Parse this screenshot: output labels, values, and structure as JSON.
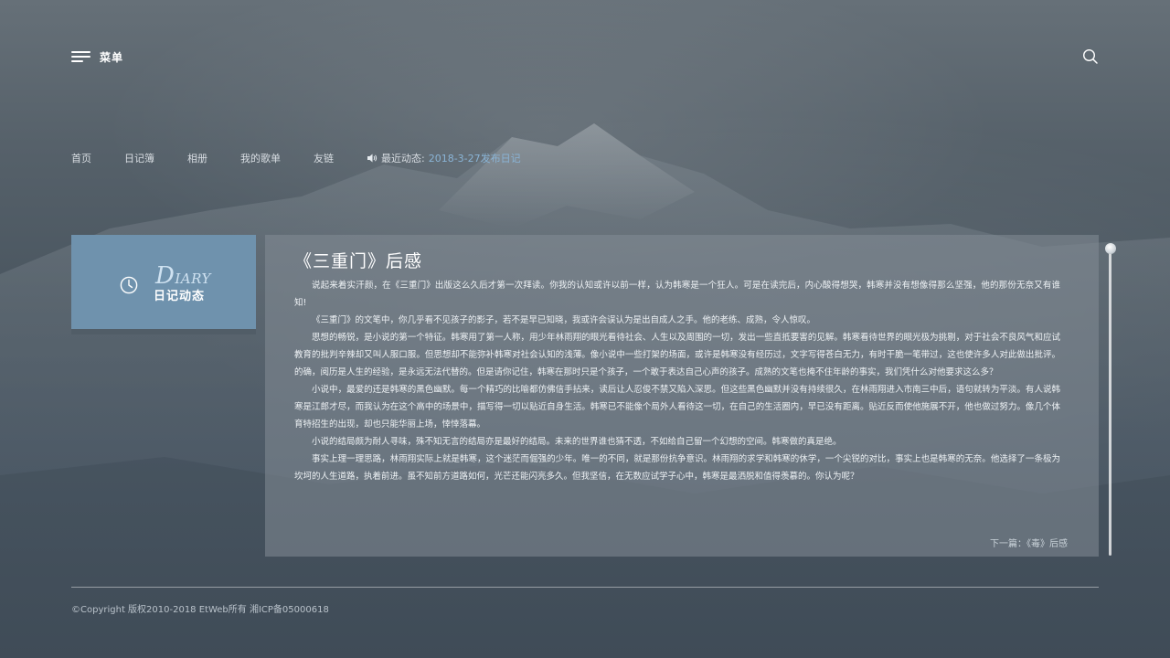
{
  "header": {
    "menu_label": "菜单",
    "menu_icon": "menu-icon",
    "search_icon": "search-icon"
  },
  "nav": {
    "items": [
      "首页",
      "日记簿",
      "相册",
      "我的歌单",
      "友链"
    ],
    "news_label": "最近动态:",
    "news_link": "2018-3-27发布日记"
  },
  "diary_card": {
    "title_initial": "D",
    "title_rest": "IARY",
    "subtitle": "日记动态",
    "color": "#6f92ad"
  },
  "article": {
    "title": "《三重门》后感",
    "paragraphs": [
      "说起来着实汗颜，在《三重门》出版这么久后才第一次拜读。你我的认知或许以前一样，认为韩寒是一个狂人。可是在读完后，内心酸得想哭，韩寒并没有想像得那么坚强，他的那份无奈又有谁知!",
      "《三重门》的文笔中，你几乎看不见孩子的影子，若不是早已知晓，我或许会误认为是出自成人之手。他的老练、成熟，令人惊叹。",
      "思想的畅锐，是小说的第一个特征。韩寒用了第一人称，用少年林雨翔的眼光看待社会、人生以及周围的一切，发出一些直抵要害的见解。韩寒看待世界的眼光极为挑剔，对于社会不良风气和应试教育的批判辛辣却又叫人服口服。但思想却不能弥补韩寒对社会认知的浅薄。像小说中一些打架的场面，或许是韩寒没有经历过，文字写得苍白无力，有时干脆一笔带过，这也使许多人对此做出批评。的确，阅历是人生的经验，是永远无法代替的。但是请你记住，韩寒在那时只是个孩子，一个敢于表达自己心声的孩子。成熟的文笔也掩不住年龄的事实，我们凭什么对他要求这么多？",
      "小说中，最爱的还是韩寒的黑色幽默。每一个精巧的比喻都仿佛信手拈来，读后让人忍俊不禁又陷入深思。但这些黑色幽默并没有持续很久，在林雨翔进入市南三中后，语句就转为平淡。有人说韩寒是江郎才尽，而我认为在这个高中的场景中，描写得一切以贴近自身生活。韩寒已不能像个局外人看待这一切，在自己的生活圈内，早已没有距离。贴近反而使他施展不开，他也做过努力。像几个体育特招生的出现，却也只能华丽上场，悻悻落幕。",
      "小说的结局颇为耐人寻味，殊不知无言的结局亦是最好的结局。未来的世界谁也猜不透，不如给自己留一个幻想的空间。韩寒做的真是绝。",
      "事实上理一理思路，林雨翔实际上就是韩寒，这个迷茫而倔强的少年。唯一的不同，就是那份抗争意识。林雨翔的求学和韩寒的休学，一个尖锐的对比，事实上也是韩寒的无奈。他选择了一条极为坎坷的人生道路，执着前进。虽不知前方道路如何，光芒还能闪亮多久。但我坚信，在无数应试学子心中，韩寒是最洒脱和值得羡慕的。你认为呢？"
    ],
    "next_label": "下一篇：《毒》后感"
  },
  "footer": {
    "copyright": "©Copyright 版权2010-2018 EtWeb所有 湘ICP备05000618"
  },
  "colors": {
    "accent_link": "#8ab4d6",
    "diary_card": "#6f92ad"
  }
}
